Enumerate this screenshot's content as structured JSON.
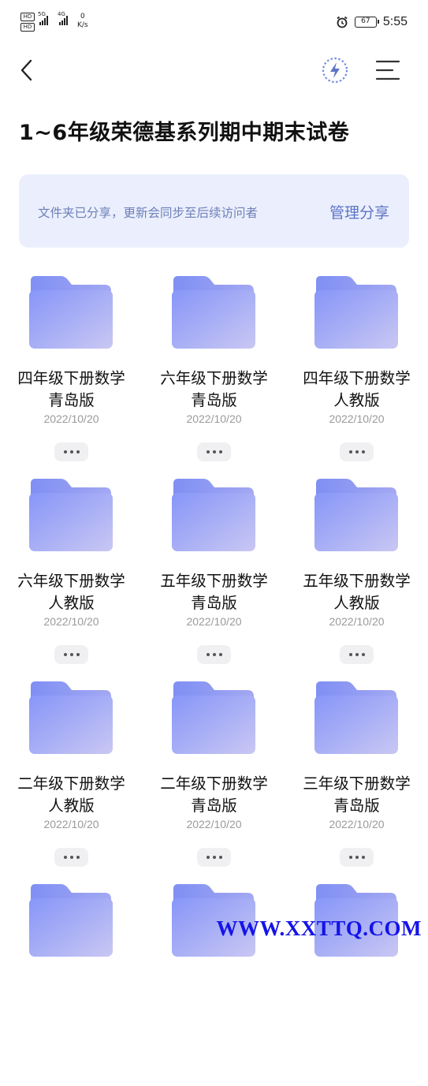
{
  "status_bar": {
    "sim1": "HD",
    "sim2": "HD",
    "signal1_tag": "5G",
    "signal2_tag": "4G",
    "net_speed_value": "0",
    "net_speed_unit": "K/s",
    "battery": "67",
    "time": "5:55"
  },
  "header": {
    "back_icon": "chevron-left-icon",
    "flash_icon": "lightning-icon",
    "menu_icon": "menu-icon"
  },
  "title": "1~6年级荣德基系列期中期末试卷",
  "share_banner": {
    "text": "文件夹已分享，更新会同步至后续访问者",
    "action": "管理分享"
  },
  "folders": [
    {
      "line1": "四年级下册数学",
      "line2": "青岛版",
      "date": "2022/10/20"
    },
    {
      "line1": "六年级下册数学",
      "line2": "青岛版",
      "date": "2022/10/20"
    },
    {
      "line1": "四年级下册数学",
      "line2": "人教版",
      "date": "2022/10/20"
    },
    {
      "line1": "六年级下册数学",
      "line2": "人教版",
      "date": "2022/10/20"
    },
    {
      "line1": "五年级下册数学",
      "line2": "青岛版",
      "date": "2022/10/20"
    },
    {
      "line1": "五年级下册数学",
      "line2": "人教版",
      "date": "2022/10/20"
    },
    {
      "line1": "二年级下册数学",
      "line2": "人教版",
      "date": "2022/10/20"
    },
    {
      "line1": "二年级下册数学",
      "line2": "青岛版",
      "date": "2022/10/20"
    },
    {
      "line1": "三年级下册数学",
      "line2": "青岛版",
      "date": "2022/10/20"
    },
    {
      "line1": "",
      "line2": "",
      "date": ""
    },
    {
      "line1": "",
      "line2": "",
      "date": ""
    },
    {
      "line1": "",
      "line2": "",
      "date": ""
    }
  ],
  "colors": {
    "accent": "#5b74c6",
    "banner_bg": "#ebeffd",
    "folder_back": "#8e9cf7",
    "folder_front": "#a9b1f7"
  },
  "watermark": "WWW.XXTTQ.COM"
}
